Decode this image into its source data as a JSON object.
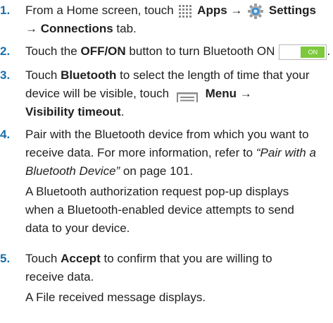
{
  "steps": [
    {
      "number": "1.",
      "lines": [
        {
          "t1": "From a Home screen, touch",
          "apps_icon": "apps-icon",
          "apps": "Apps",
          "arrow": "→",
          "settings_icon": "gear-icon",
          "settings": "Settings"
        },
        {
          "arrow": "→",
          "tab": "Connections",
          "tail": "tab."
        }
      ]
    },
    {
      "number": "2.",
      "lines": [
        {
          "t1": "Touch the",
          "button": "OFF/ON",
          "t2": "button to turn Bluetooth ON",
          "toggle_label": "ON",
          "period": "."
        }
      ]
    },
    {
      "number": "3.",
      "lines": [
        {
          "t1": "Touch",
          "bluetooth": "Bluetooth",
          "t2": "to select the length of time that your"
        },
        {
          "t1": "device will be visible, touch",
          "menu_icon": "menu-icon",
          "menu": "Menu",
          "arrow": "→"
        },
        {
          "timeout": "Visibility timeout",
          "period": "."
        }
      ]
    },
    {
      "number": "4.",
      "lines": [
        {
          "text": "Pair with the Bluetooth device from which you want to"
        },
        {
          "t1": "receive data. For more information, refer to",
          "ref": "“Pair with a"
        },
        {
          "ref": "Bluetooth Device”",
          "t2": "on page 101."
        }
      ],
      "note_lines": [
        "A Bluetooth authorization request pop-up displays",
        "when a Bluetooth-enabled device attempts to send",
        "data to your device."
      ]
    },
    {
      "number": "5.",
      "lines": [
        {
          "t1": "Touch",
          "accept": "Accept",
          "t2": "to confirm that you are willing to"
        },
        {
          "text": "receive data."
        }
      ],
      "note_lines": [
        "A File received message displays."
      ]
    }
  ],
  "colors": {
    "step_number": "#1a6ea8",
    "toggle_on": "#7cc93b",
    "gear": "#3d8fd1",
    "apps_grid": "#8a8a8a"
  }
}
